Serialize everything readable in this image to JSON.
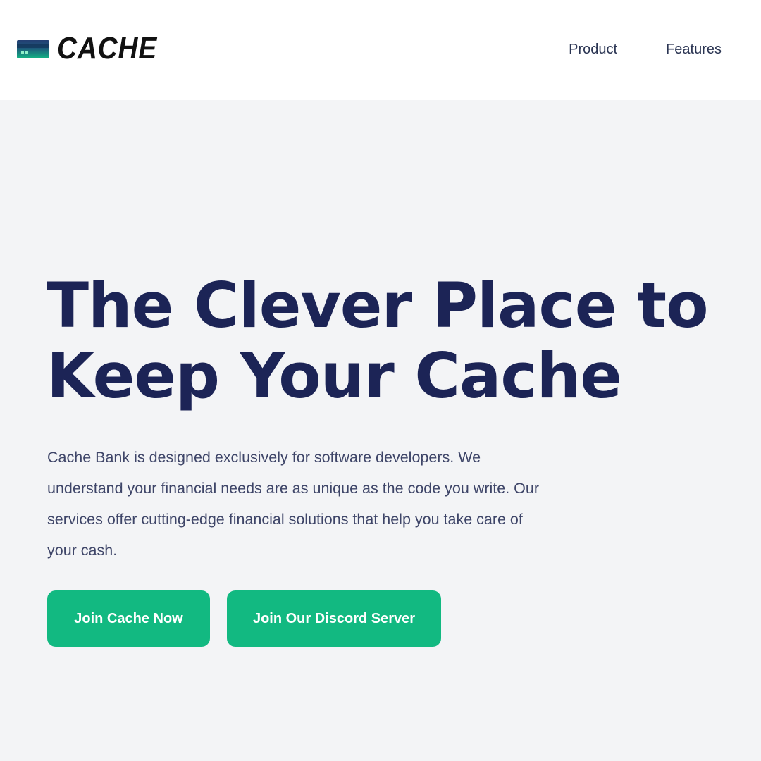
{
  "brand": {
    "name": "CACHE",
    "icon": "credit-card-icon",
    "colors": {
      "card_top": "#1f3b6e",
      "card_bottom": "#13b584"
    }
  },
  "nav": {
    "items": [
      {
        "label": "Product"
      },
      {
        "label": "Features"
      }
    ]
  },
  "hero": {
    "title_line1": "The Clever Place to",
    "title_line2": "Keep Your Cache",
    "description": "Cache Bank is designed exclusively for software developers. We understand your financial needs are as unique as the code you write. Our services offer cutting-edge financial solutions that help you take care of your cash.",
    "primary_cta": "Join Cache Now",
    "secondary_cta": "Join Our Discord Server"
  },
  "colors": {
    "background": "#f3f4f6",
    "header_bg": "#ffffff",
    "title": "#1c2456",
    "accent": "#12b981"
  }
}
